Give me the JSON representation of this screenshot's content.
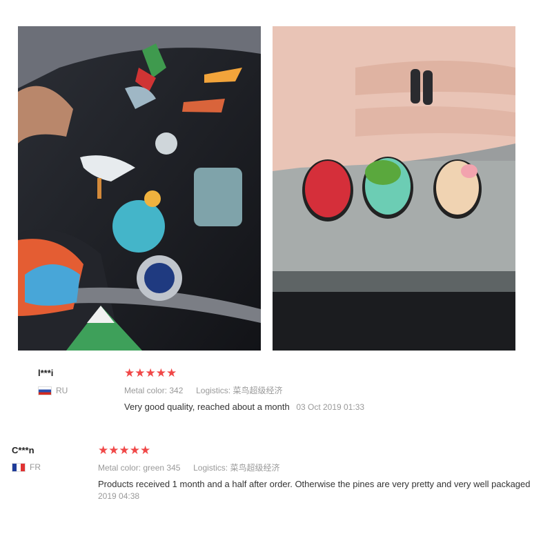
{
  "reviews": [
    {
      "user": "l***i",
      "country": "RU",
      "rating_stars": "★★★★★",
      "metal_label": "Metal color:",
      "metal_value": "342",
      "logistics_label": "Logistics:",
      "logistics_value": "菜鸟超级经济",
      "text": "Very good quality, reached about a month",
      "date": "03 Oct 2019 01:33",
      "rating": 5,
      "flag_icon": "flag-russia-icon"
    },
    {
      "user": "C***n",
      "country": "FR",
      "rating_stars": "★★★★★",
      "metal_label": "Metal color:",
      "metal_value": "green 345",
      "logistics_label": "Logistics:",
      "logistics_value": "菜鸟超级经济",
      "text": "Products received 1 month and a half after order. Otherwise the pines are very pretty and very well packaged",
      "date": "2019 04:38",
      "rating": 5,
      "flag_icon": "flag-france-icon"
    }
  ],
  "colors": {
    "star": "#f04848",
    "muted": "#999999",
    "text": "#333333"
  }
}
